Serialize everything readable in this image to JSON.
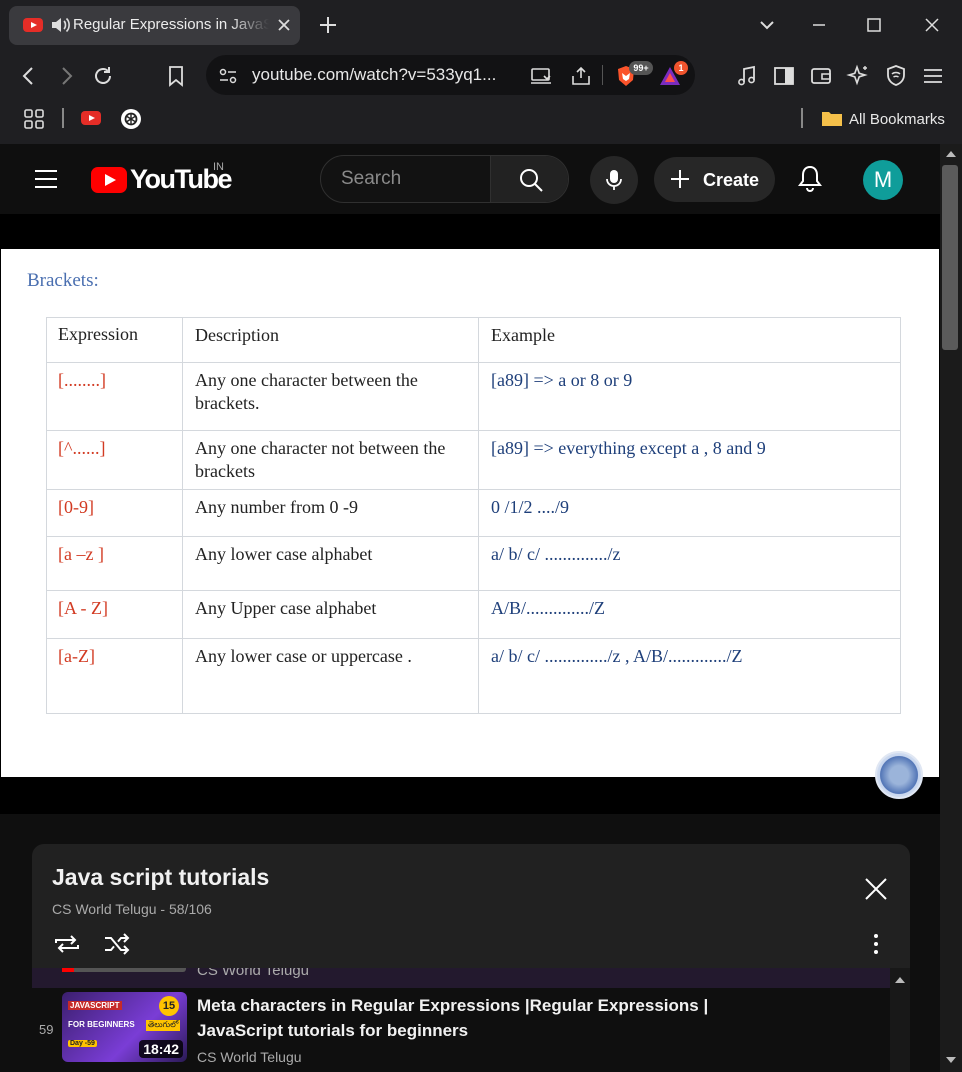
{
  "browser": {
    "tab_title": "Regular Expressions in JavaScript",
    "url": "youtube.com/watch?v=533yq1...",
    "brave_badge": "99+",
    "rewards_badge": "1",
    "all_bookmarks": "All Bookmarks"
  },
  "youtube": {
    "logo_text": "YouTube",
    "country": "IN",
    "search_placeholder": "Search",
    "create_label": "Create",
    "avatar_letter": "M"
  },
  "slide": {
    "heading": "Brackets:",
    "columns": [
      "Expression",
      "Description",
      "Example"
    ],
    "rows": [
      {
        "expr": "[........]",
        "desc": "Any one character between the brackets.",
        "example": "[a89] => a or 8 or 9"
      },
      {
        "expr": "[^......]",
        "desc": "Any one character not between the brackets",
        "example": "[a89] => everything except a , 8  and  9"
      },
      {
        "expr": "[0-9]",
        "desc": "Any number from 0 -9",
        "example": "0 /1/2 ..../9"
      },
      {
        "expr": "[a –z ]",
        "desc": "Any lower case alphabet",
        "example": "a/ b/ c/ ............../z"
      },
      {
        "expr": "[A  - Z]",
        "desc": "Any Upper  case alphabet",
        "example": "A/B/............../Z"
      },
      {
        "expr": "[a-Z]",
        "desc": "Any lower case or uppercase .",
        "example": "a/ b/ c/ ............../z , A/B/............./Z"
      }
    ]
  },
  "playlist": {
    "title": "Java script tutorials",
    "subtitle": "CS World Telugu - 58/106",
    "previous_channel": "CS World Telugu",
    "current_item": {
      "index": "59",
      "title": "Meta characters in Regular Expressions |Regular Expressions | JavaScript tutorials for beginners",
      "channel": "CS World Telugu",
      "duration": "18:42",
      "thumb_tag": "JAVASCRIPT",
      "thumb_line": "FOR BEGINNERS",
      "thumb_day": "Day -59",
      "thumb_num": "15",
      "thumb_telugu": "తెలుగులో"
    }
  }
}
